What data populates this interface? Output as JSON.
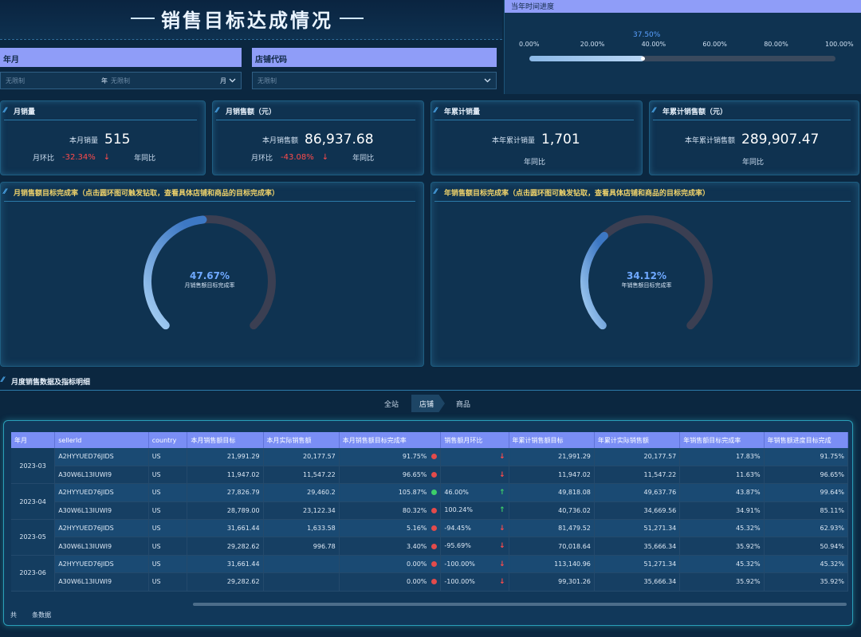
{
  "header": {
    "title": "销售目标达成情况"
  },
  "filters": {
    "year_month": {
      "label": "年月",
      "from_placeholder": "无限制",
      "year_suffix": "年",
      "to_placeholder": "无限制",
      "month_suffix": "月"
    },
    "store_code": {
      "label": "店铺代码",
      "placeholder": "无限制"
    }
  },
  "time_progress": {
    "label": "当年时间进度",
    "current_label": "37.50%",
    "current_fraction": 0.375,
    "ticks": [
      "0.00%",
      "20.00%",
      "40.00%",
      "60.00%",
      "80.00%",
      "100.00%"
    ]
  },
  "kpis": [
    {
      "title": "月销量",
      "label": "本月销量",
      "value": "515",
      "mom_label": "月环比",
      "mom_value": "-32.34%",
      "yoy_label": "年同比"
    },
    {
      "title": "月销售额（元）",
      "label": "本月销售额",
      "value": "86,937.68",
      "mom_label": "月环比",
      "mom_value": "-43.08%",
      "yoy_label": "年同比"
    },
    {
      "title": "年累计销量",
      "label": "本年累计销量",
      "value": "1,701",
      "yoy_label": "年同比"
    },
    {
      "title": "年累计销售额（元）",
      "label": "本年累计销售额",
      "value": "289,907.47",
      "yoy_label": "年同比"
    }
  ],
  "gauges": [
    {
      "title": "月销售额目标完成率（点击圆环图可触发钻取，查看具体店铺和商品的目标完成率）",
      "value_label": "47.67%",
      "fraction": 0.4767,
      "sub_label": "月销售额目标完成率"
    },
    {
      "title": "年销售额目标完成率（点击圆环图可触发钻取，查看具体店铺和商品的目标完成率）",
      "value_label": "34.12%",
      "fraction": 0.3412,
      "sub_label": "年销售额目标完成率"
    }
  ],
  "detail": {
    "title": "月度销售数据及指标明细",
    "breadcrumb": [
      "全站",
      "店铺",
      "商品"
    ],
    "columns": [
      "年月",
      "sellerId",
      "country",
      "本月销售额目标",
      "本月实际销售额",
      "本月销售额目标完成率",
      "销售额月环比",
      "年累计销售额目标",
      "年累计实际销售额",
      "年销售额目标完成率",
      "年销售额进度目标完成"
    ],
    "groups": [
      {
        "month": "2023-03",
        "rows": [
          {
            "seller": "A2HYYUED76JIDS",
            "country": "US",
            "m_target": "21,991.29",
            "m_actual": "20,177.57",
            "m_rate": "91.75%",
            "dot": "#e24b4b",
            "mom": "",
            "trend": "down",
            "y_target": "21,991.29",
            "y_actual": "20,177.57",
            "y_rate": "17.83%",
            "y_prog": "91.75%"
          },
          {
            "seller": "A30W6L13IUWI9",
            "country": "US",
            "m_target": "11,947.02",
            "m_actual": "11,547.22",
            "m_rate": "96.65%",
            "dot": "#e24b4b",
            "mom": "",
            "trend": "down",
            "y_target": "11,947.02",
            "y_actual": "11,547.22",
            "y_rate": "11.63%",
            "y_prog": "96.65%"
          }
        ]
      },
      {
        "month": "2023-04",
        "rows": [
          {
            "seller": "A2HYYUED76JIDS",
            "country": "US",
            "m_target": "27,826.79",
            "m_actual": "29,460.2",
            "m_rate": "105.87%",
            "dot": "#3ccf6a",
            "mom": "46.00%",
            "trend": "up",
            "y_target": "49,818.08",
            "y_actual": "49,637.76",
            "y_rate": "43.87%",
            "y_prog": "99.64%"
          },
          {
            "seller": "A30W6L13IUWI9",
            "country": "US",
            "m_target": "28,789.00",
            "m_actual": "23,122.34",
            "m_rate": "80.32%",
            "dot": "#e24b4b",
            "mom": "100.24%",
            "trend": "up",
            "y_target": "40,736.02",
            "y_actual": "34,669.56",
            "y_rate": "34.91%",
            "y_prog": "85.11%"
          }
        ]
      },
      {
        "month": "2023-05",
        "rows": [
          {
            "seller": "A2HYYUED76JIDS",
            "country": "US",
            "m_target": "31,661.44",
            "m_actual": "1,633.58",
            "m_rate": "5.16%",
            "dot": "#e24b4b",
            "mom": "-94.45%",
            "trend": "down",
            "y_target": "81,479.52",
            "y_actual": "51,271.34",
            "y_rate": "45.32%",
            "y_prog": "62.93%"
          },
          {
            "seller": "A30W6L13IUWI9",
            "country": "US",
            "m_target": "29,282.62",
            "m_actual": "996.78",
            "m_rate": "3.40%",
            "dot": "#e24b4b",
            "mom": "-95.69%",
            "trend": "down",
            "y_target": "70,018.64",
            "y_actual": "35,666.34",
            "y_rate": "35.92%",
            "y_prog": "50.94%"
          }
        ]
      },
      {
        "month": "2023-06",
        "rows": [
          {
            "seller": "A2HYYUED76JIDS",
            "country": "US",
            "m_target": "31,661.44",
            "m_actual": "",
            "m_rate": "0.00%",
            "dot": "#e24b4b",
            "mom": "-100.00%",
            "trend": "down",
            "y_target": "113,140.96",
            "y_actual": "51,271.34",
            "y_rate": "45.32%",
            "y_prog": "45.32%"
          },
          {
            "seller": "A30W6L13IUWI9",
            "country": "US",
            "m_target": "29,282.62",
            "m_actual": "",
            "m_rate": "0.00%",
            "dot": "#e24b4b",
            "mom": "-100.00%",
            "trend": "down",
            "y_target": "99,301.26",
            "y_actual": "35,666.34",
            "y_rate": "35.92%",
            "y_prog": "35.92%"
          }
        ]
      }
    ],
    "footer_prefix": "共",
    "footer_suffix": "条数据"
  }
}
